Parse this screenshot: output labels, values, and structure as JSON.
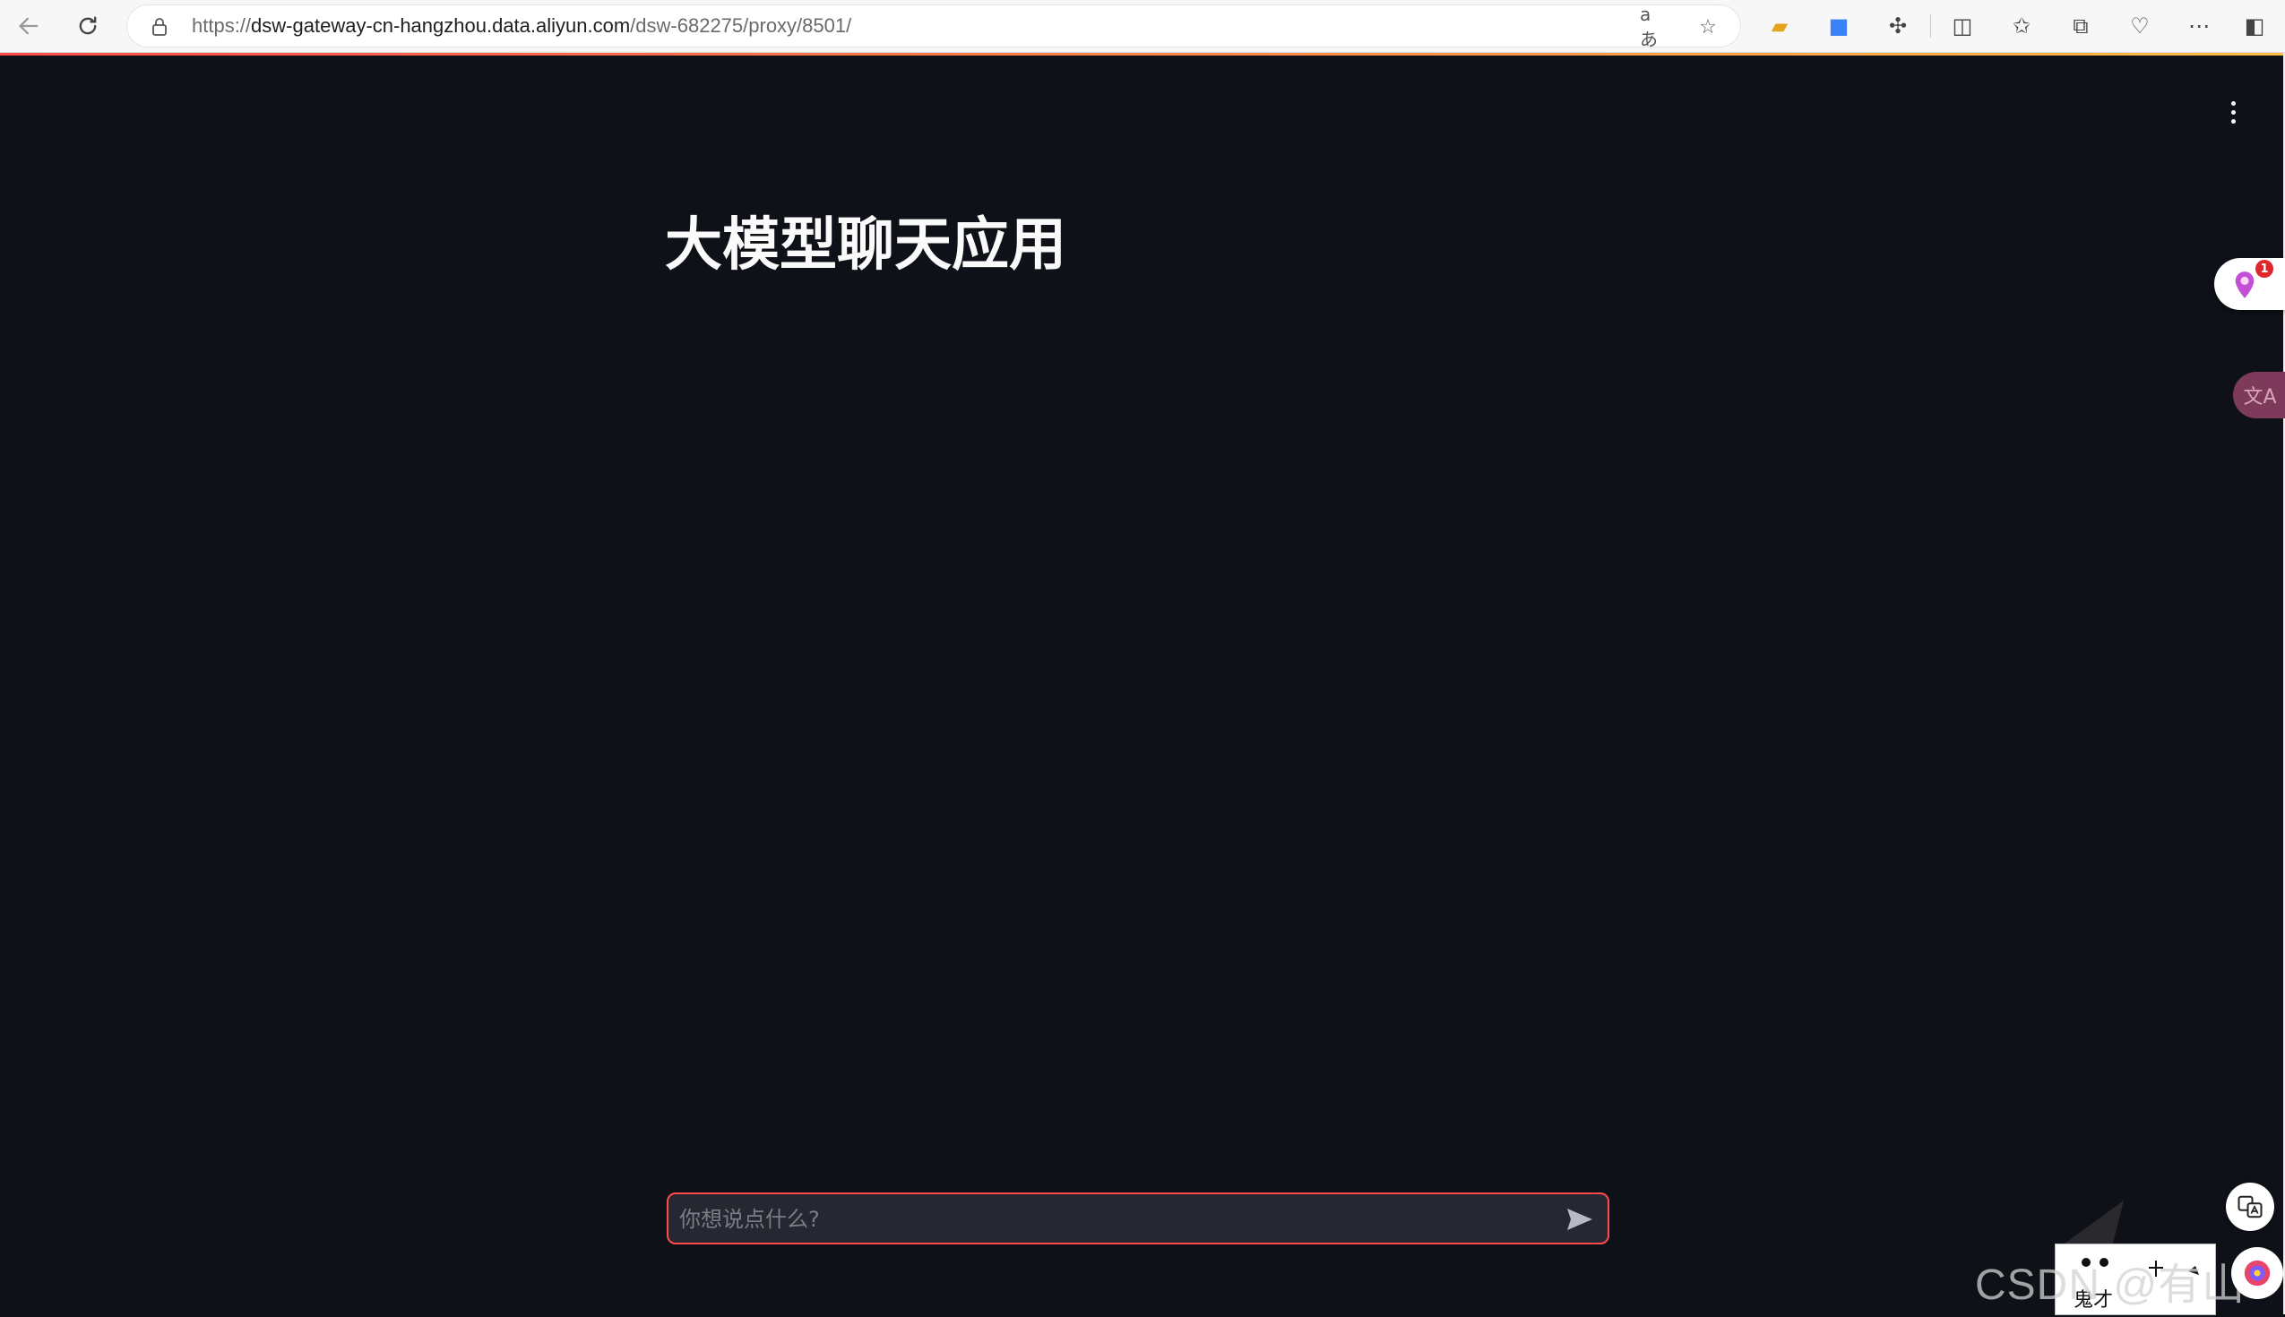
{
  "browser": {
    "url_scheme": "https://",
    "url_host": "dsw-gateway-cn-hangzhou.data.aliyun.com",
    "url_path": "/dsw-682275/proxy/8501/",
    "read_aloud_icon_text": "aあ"
  },
  "app": {
    "title": "大模型聊天应用",
    "chat_input": {
      "value": "",
      "placeholder": "你想说点什么?"
    },
    "accent_color": "#ff4b4b",
    "background_color": "#0e1117"
  },
  "widgets": {
    "notification_badge": "1",
    "translate_label": "文A",
    "mascot_label": "鬼才",
    "watermark": "CSDN @有山"
  }
}
